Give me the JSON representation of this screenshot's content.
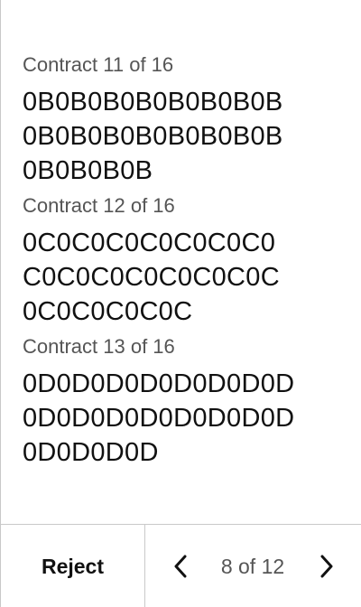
{
  "contracts": [
    {
      "label": "Contract 11 of 16",
      "lines": [
        "0B0B0B0B0B0B0B0B",
        "0B0B0B0B0B0B0B0B",
        "0B0B0B0B"
      ]
    },
    {
      "label": "Contract 12 of 16",
      "lines": [
        "0C0C0C0C0C0C0C0",
        "C0C0C0C0C0C0C0C",
        "0C0C0C0C0C"
      ]
    },
    {
      "label": "Contract 13 of 16",
      "lines": [
        "0D0D0D0D0D0D0D0D",
        "0D0D0D0D0D0D0D0D",
        "0D0D0D0D"
      ]
    }
  ],
  "footer": {
    "reject_label": "Reject",
    "page_indicator": "8 of 12",
    "prev_icon": "chevron-left-icon",
    "next_icon": "chevron-right-icon"
  }
}
